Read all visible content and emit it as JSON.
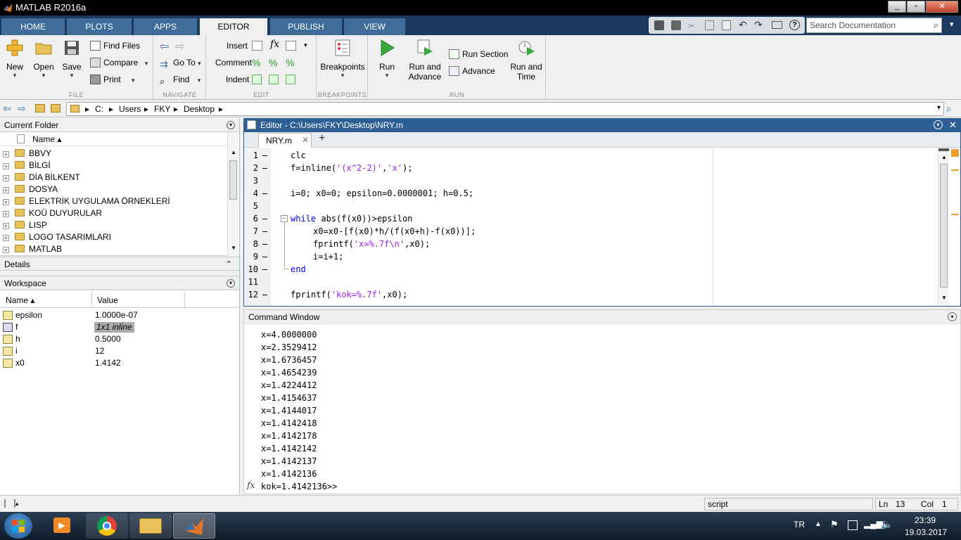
{
  "window": {
    "title": "MATLAB R2016a"
  },
  "tabs": [
    "HOME",
    "PLOTS",
    "APPS",
    "EDITOR",
    "PUBLISH",
    "VIEW"
  ],
  "active_tab": "EDITOR",
  "search": {
    "placeholder": "Search Documentation"
  },
  "ribbon": {
    "file": {
      "section": "FILE",
      "new": "New",
      "open": "Open",
      "save": "Save",
      "find_files": "Find Files",
      "compare": "Compare",
      "print": "Print"
    },
    "navigate": {
      "section": "NAVIGATE",
      "go_to": "Go To",
      "find": "Find"
    },
    "edit": {
      "section": "EDIT",
      "insert": "Insert",
      "comment": "Comment",
      "indent": "Indent",
      "fx": "fx"
    },
    "breakpoints": {
      "section": "BREAKPOINTS",
      "label": "Breakpoints"
    },
    "run": {
      "section": "RUN",
      "run": "Run",
      "run_and_advance": "Run and Advance",
      "run_section": "Run Section",
      "advance": "Advance",
      "run_and_time": "Run and Time"
    }
  },
  "address": {
    "parts": [
      "C:",
      "Users",
      "FKY",
      "Desktop"
    ],
    "sep": ">",
    "end": "▸"
  },
  "current_folder": {
    "title": "Current Folder",
    "column": "Name ▴",
    "items": [
      "BBVY",
      "BİLGİ",
      "DİA BİLKENT",
      "DOSYA",
      "ELEKTRİK UYGULAMA ÖRNEKLERİ",
      "KOÜ DUYURULAR",
      "LISP",
      "LOGO TASARIMLARI",
      "MATLAB"
    ]
  },
  "details": {
    "title": "Details"
  },
  "workspace": {
    "title": "Workspace",
    "columns": {
      "name": "Name ▴",
      "value": "Value"
    },
    "vars": [
      {
        "name": "epsilon",
        "value": "1.0000e-07"
      },
      {
        "name": "f",
        "value": "1x1 inline"
      },
      {
        "name": "h",
        "value": "0.5000"
      },
      {
        "name": "i",
        "value": "12"
      },
      {
        "name": "x0",
        "value": "1.4142"
      }
    ]
  },
  "editor": {
    "title": "Editor - C:\\Users\\FKY\\Desktop\\NRY.m",
    "tab": "NRY.m",
    "add_tab": "+",
    "line_numbers": [
      "1",
      "2",
      "3",
      "4",
      "5",
      "6",
      "7",
      "8",
      "9",
      "10",
      "11",
      "12"
    ],
    "lines": {
      "l1": "clc",
      "l2a": "f=inline(",
      "l2b": "'(x^2-2)'",
      "l2c": ",",
      "l2d": "'x'",
      "l2e": ");",
      "l4": "i=0; x0=0; epsilon=0.0000001; h=0.5;",
      "l6a": "while",
      "l6b": " abs(f(x0))>epsilon",
      "l7": "x0=x0-[f(x0)*h/(f(x0+h)-f(x0))];",
      "l8a": "fprintf(",
      "l8b": "'x=%.7f\\n'",
      "l8c": ",x0);",
      "l9": "i=i+1;",
      "l10": "end",
      "l12a": "fprintf(",
      "l12b": "'kok=%.7f'",
      "l12c": ",x0);"
    }
  },
  "command_window": {
    "title": "Command Window",
    "output": [
      "x=4.0000000",
      "x=2.3529412",
      "x=1.6736457",
      "x=1.4654239",
      "x=1.4224412",
      "x=1.4154637",
      "x=1.4144017",
      "x=1.4142418",
      "x=1.4142178",
      "x=1.4142142",
      "x=1.4142137",
      "x=1.4142136"
    ],
    "prompt": "fx",
    "last": "kok=1.4142136>>"
  },
  "status": {
    "mode": "script",
    "ln_label": "Ln",
    "ln": "13",
    "col_label": "Col",
    "col": "1"
  },
  "taskbar": {
    "lang": "TR",
    "time": "23:39",
    "date": "19.03.2017"
  },
  "colors": {
    "accent": "#1b3a5e",
    "tab": "#3f6c98",
    "editor_header": "#2d5f94",
    "keyword": "#0000ff",
    "string": "#a020f0"
  }
}
